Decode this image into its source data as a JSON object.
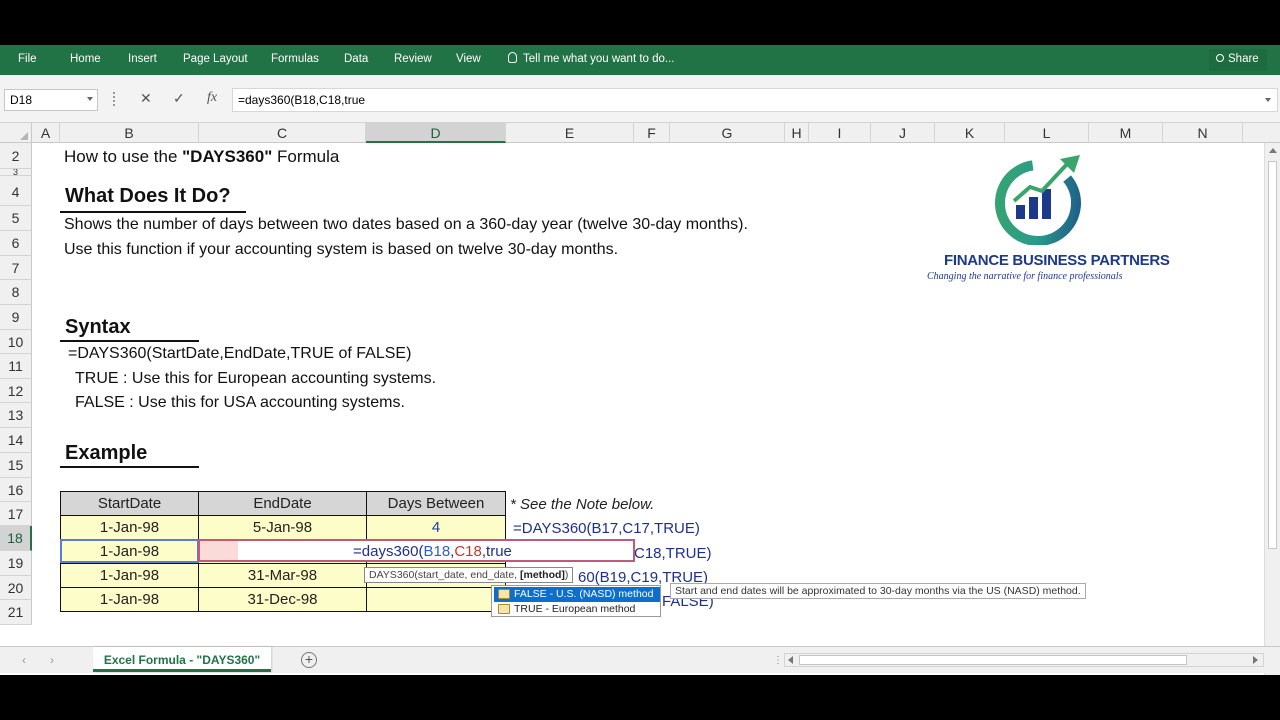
{
  "ribbon": {
    "tabs": [
      "File",
      "Home",
      "Insert",
      "Page Layout",
      "Formulas",
      "Data",
      "Review",
      "View"
    ],
    "tell_me": "Tell me what you want to do...",
    "share": "Share"
  },
  "formula_bar": {
    "name_box": "D18",
    "cancel_icon": "✕",
    "enter_icon": "✓",
    "fx_icon": "fx",
    "formula": "=days360(B18,C18,true"
  },
  "columns": [
    "A",
    "B",
    "C",
    "D",
    "E",
    "F",
    "G",
    "H",
    "I",
    "J",
    "K",
    "L",
    "M",
    "N"
  ],
  "rows": [
    "2",
    "3",
    "4",
    "5",
    "6",
    "7",
    "8",
    "9",
    "10",
    "11",
    "12",
    "13",
    "14",
    "15",
    "16",
    "17",
    "18",
    "19",
    "20",
    "21"
  ],
  "content": {
    "title_prefix": "How to use the ",
    "title_bold": "\"DAYS360\"",
    "title_suffix": " Formula",
    "h_what": "What Does It Do?",
    "desc1": "Shows the number of days between two dates based on a 360-day year (twelve 30-day months).",
    "desc2": "Use this function if your accounting system is based on twelve 30-day months.",
    "h_syntax": "Syntax",
    "syntax": "=DAYS360(StartDate,EndDate,TRUE of FALSE)",
    "true_line": "TRUE : Use this for European accounting systems.",
    "false_line": "FALSE : Use this for USA accounting systems.",
    "h_example": "Example",
    "note": "* See the Note below."
  },
  "table": {
    "headers": [
      "StartDate",
      "EndDate",
      "Days Between"
    ],
    "rows": [
      {
        "start": "1-Jan-98",
        "end": "5-Jan-98",
        "days": "4"
      },
      {
        "start": "1-Jan-98",
        "end": "",
        "days": ""
      },
      {
        "start": "1-Jan-98",
        "end": "31-Mar-98",
        "days": ""
      },
      {
        "start": "1-Jan-98",
        "end": "31-Dec-98",
        "days": ""
      }
    ]
  },
  "formulas_col_e": {
    "r17": "=DAYS360(B17,C17,TRUE)",
    "r18": "C18,TRUE)",
    "r19": "60(B19,C19,TRUE)",
    "r20": "FALSE)"
  },
  "editing": {
    "prefix": "=days360(",
    "ref1": "B18",
    "comma1": ",",
    "ref2": "C18",
    "suffix": ",true"
  },
  "tooltip": {
    "arg_prefix": "DAYS360(start_date, end_date, ",
    "arg_current": "[method]",
    "arg_suffix": ")",
    "options": [
      "FALSE - U.S. (NASD) method",
      "TRUE - European method"
    ],
    "description": "Start and end dates will be approximated to 30-day months via the US (NASD) method."
  },
  "logo": {
    "name": "FINANCE BUSINESS PARTNERS",
    "tagline": "Changing the narrative for finance professionals",
    "colors": {
      "teal": "#2a9c8a",
      "navy": "#1d3a8a",
      "green": "#3aa56b"
    }
  },
  "sheet_tab": "Excel Formula - \"DAYS360\"",
  "accent": "#217346"
}
